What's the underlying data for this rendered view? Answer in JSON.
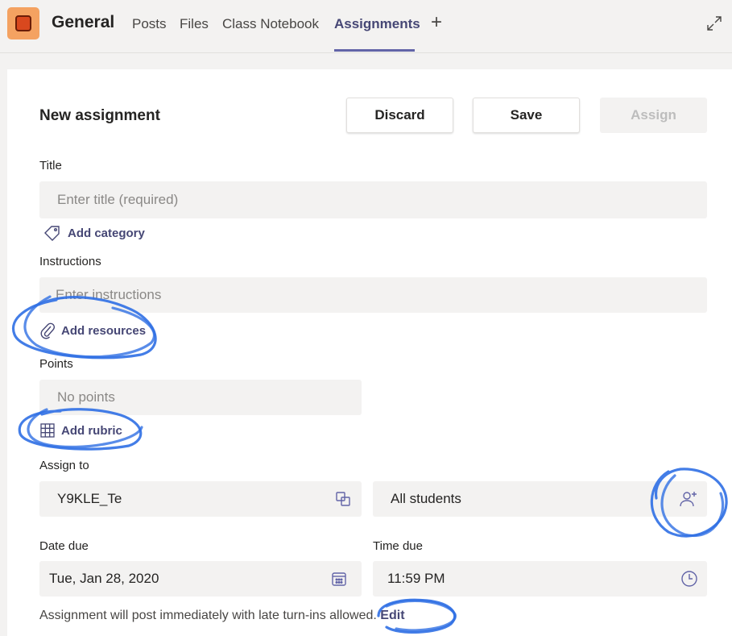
{
  "header": {
    "channel_name": "General",
    "tabs": [
      {
        "label": "Posts"
      },
      {
        "label": "Files"
      },
      {
        "label": "Class Notebook"
      },
      {
        "label": "Assignments"
      }
    ],
    "add_tab": "+",
    "accent_color": "#6264a7"
  },
  "form": {
    "title": "New assignment",
    "discard_label": "Discard",
    "save_label": "Save",
    "assign_label": "Assign",
    "title_label": "Title",
    "title_placeholder": "Enter title (required)",
    "add_category": "Add category",
    "instructions_label": "Instructions",
    "instructions_placeholder": "Enter instructions",
    "add_resources": "Add resources",
    "points_label": "Points",
    "points_placeholder": "No points",
    "add_rubric": "Add rubric",
    "assign_to_label": "Assign to",
    "class_value": "Y9KLE_Te",
    "students_value": "All students",
    "date_due_label": "Date due",
    "date_due_value": "Tue, Jan 28, 2020",
    "time_due_label": "Time due",
    "time_due_value": "11:59 PM",
    "footer_text": "Assignment will post immediately with late turn-ins allowed.",
    "edit_label": "Edit"
  },
  "icons": {
    "expand": "expand-icon",
    "tag": "tag-icon",
    "paperclip": "paperclip-icon",
    "table": "table-icon",
    "copy": "copy-icon",
    "add_person": "add-person-icon",
    "calendar": "calendar-icon",
    "clock": "clock-icon"
  }
}
